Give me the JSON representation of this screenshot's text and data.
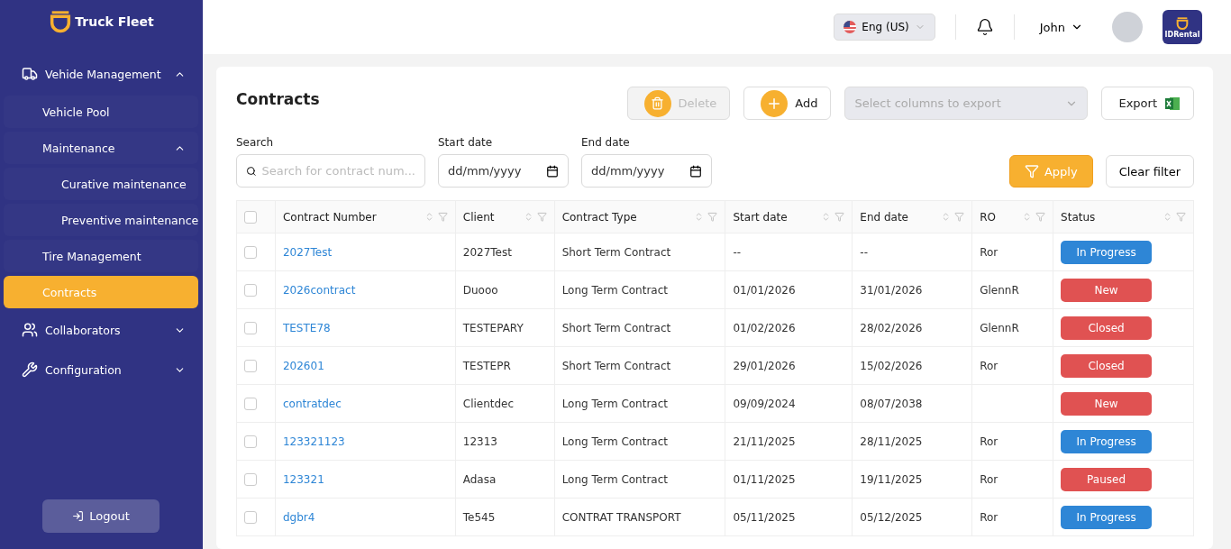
{
  "brand": {
    "name": "Truck Fleet"
  },
  "sidebar": {
    "items": [
      {
        "label": "Vehide Management",
        "expanded": true,
        "selected": false,
        "children": [
          {
            "label": "Vehicle Pool",
            "selected": false
          },
          {
            "label": "Maintenance",
            "expanded": true,
            "selected": false,
            "children": [
              {
                "label": "Curative maintenance",
                "selected": false
              },
              {
                "label": "Preventive maintenance",
                "selected": false
              }
            ]
          },
          {
            "label": "Tire Management",
            "selected": false
          },
          {
            "label": "Contracts",
            "selected": true
          }
        ]
      },
      {
        "label": "Collaborators",
        "expanded": false,
        "selected": false
      },
      {
        "label": "Configuration",
        "expanded": false,
        "selected": false
      }
    ],
    "logout": "Logout"
  },
  "topbar": {
    "language": "Eng (US)",
    "user": "John",
    "app_logo": "IDRental"
  },
  "page": {
    "title": "Contracts",
    "delete": {
      "label": "Delete",
      "disabled": true
    },
    "add": "Add",
    "export_select": {
      "placeholder": "Select columns to export"
    },
    "export": "Export",
    "filters": {
      "search": {
        "label": "Search",
        "placeholder": "Search for contract num..."
      },
      "start_date": {
        "label": "Start date",
        "placeholder": "dd/mm/yyyy"
      },
      "end_date": {
        "label": "End date",
        "placeholder": "dd/mm/yyyy"
      },
      "apply": "Apply",
      "clear": "Clear filter"
    }
  },
  "table": {
    "select_all_checked": false,
    "columns": [
      "Contract Number",
      "Client",
      "Contract Type",
      "Start date",
      "End date",
      "RO",
      "Status"
    ],
    "rows": [
      {
        "checked": false,
        "cells": [
          "2027Test",
          "2027Test",
          "Short Term Contract",
          "--",
          "--",
          "Ror"
        ],
        "status": "In Progress",
        "color": "#2e86d6"
      },
      {
        "checked": false,
        "cells": [
          "2026contract",
          "Duooo",
          "Long Term Contract",
          "01/01/2026",
          "31/01/2026",
          "GlennR"
        ],
        "status": "New",
        "color": "#e05252"
      },
      {
        "checked": false,
        "cells": [
          "TESTE78",
          "TESTEPARY",
          "Short Term Contract",
          "01/02/2026",
          "28/02/2026",
          "GlennR"
        ],
        "status": "Closed",
        "color": "#e05252"
      },
      {
        "checked": false,
        "cells": [
          "202601",
          "TESTEPR",
          "Short Term Contract",
          "29/01/2026",
          "15/02/2026",
          "Ror"
        ],
        "status": "Closed",
        "color": "#e05252"
      },
      {
        "checked": false,
        "cells": [
          "contratdec",
          "Clientdec",
          "Long Term Contract",
          "09/09/2024",
          "08/07/2038",
          ""
        ],
        "status": "New",
        "color": "#e05252"
      },
      {
        "checked": false,
        "cells": [
          "123321123",
          "12313",
          "Long Term Contract",
          "21/11/2025",
          "28/11/2025",
          "Ror"
        ],
        "status": "In Progress",
        "color": "#2e86d6"
      },
      {
        "checked": false,
        "cells": [
          "123321",
          "Adasa",
          "Long Term Contract",
          "01/11/2025",
          "19/11/2025",
          "Ror"
        ],
        "status": "Paused",
        "color": "#e05252"
      },
      {
        "checked": false,
        "cells": [
          "dgbr4",
          "Te545",
          "CONTRAT TRANSPORT",
          "05/11/2025",
          "05/12/2025",
          "Ror"
        ],
        "status": "In Progress",
        "color": "#2e86d6"
      }
    ]
  }
}
